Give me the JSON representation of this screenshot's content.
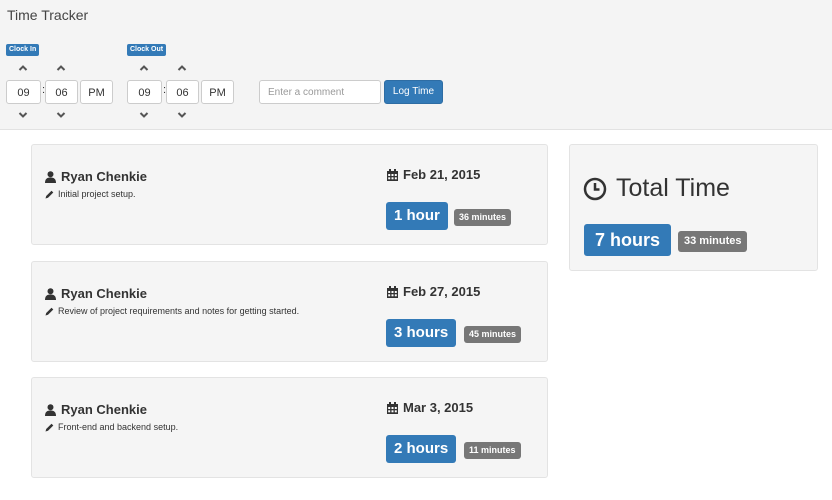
{
  "app": {
    "title": "Time Tracker"
  },
  "clock_in": {
    "label": "Clock In",
    "hour": "09",
    "minute": "06",
    "meridian": "PM"
  },
  "clock_out": {
    "label": "Clock Out",
    "hour": "09",
    "minute": "06",
    "meridian": "PM"
  },
  "time_separator": ":",
  "comment": {
    "placeholder": "Enter a comment",
    "value": ""
  },
  "log_button": {
    "label": "Log Time"
  },
  "entries": [
    {
      "user": "Ryan Chenkie",
      "comment": "Initial project setup.",
      "date": "Feb 21, 2015",
      "hours": "1 hour",
      "minutes": "36 minutes"
    },
    {
      "user": "Ryan Chenkie",
      "comment": "Review of project requirements and notes for getting started.",
      "date": "Feb 27, 2015",
      "hours": "3 hours",
      "minutes": "45 minutes"
    },
    {
      "user": "Ryan Chenkie",
      "comment": "Front-end and backend setup.",
      "date": "Mar 3, 2015",
      "hours": "2 hours",
      "minutes": "11 minutes"
    }
  ],
  "total": {
    "title": "Total Time",
    "hours": "7 hours",
    "minutes": "33 minutes"
  },
  "icons": {
    "user": "user-icon",
    "comment": "pencil-icon",
    "date": "calendar-icon",
    "total": "clock-icon",
    "increment": "chevron-up-icon",
    "decrement": "chevron-down-icon"
  },
  "colors": {
    "primary": "#337ab7",
    "muted_badge": "#777777",
    "panel": "#f5f5f5",
    "topbar": "#f4f4f4"
  }
}
